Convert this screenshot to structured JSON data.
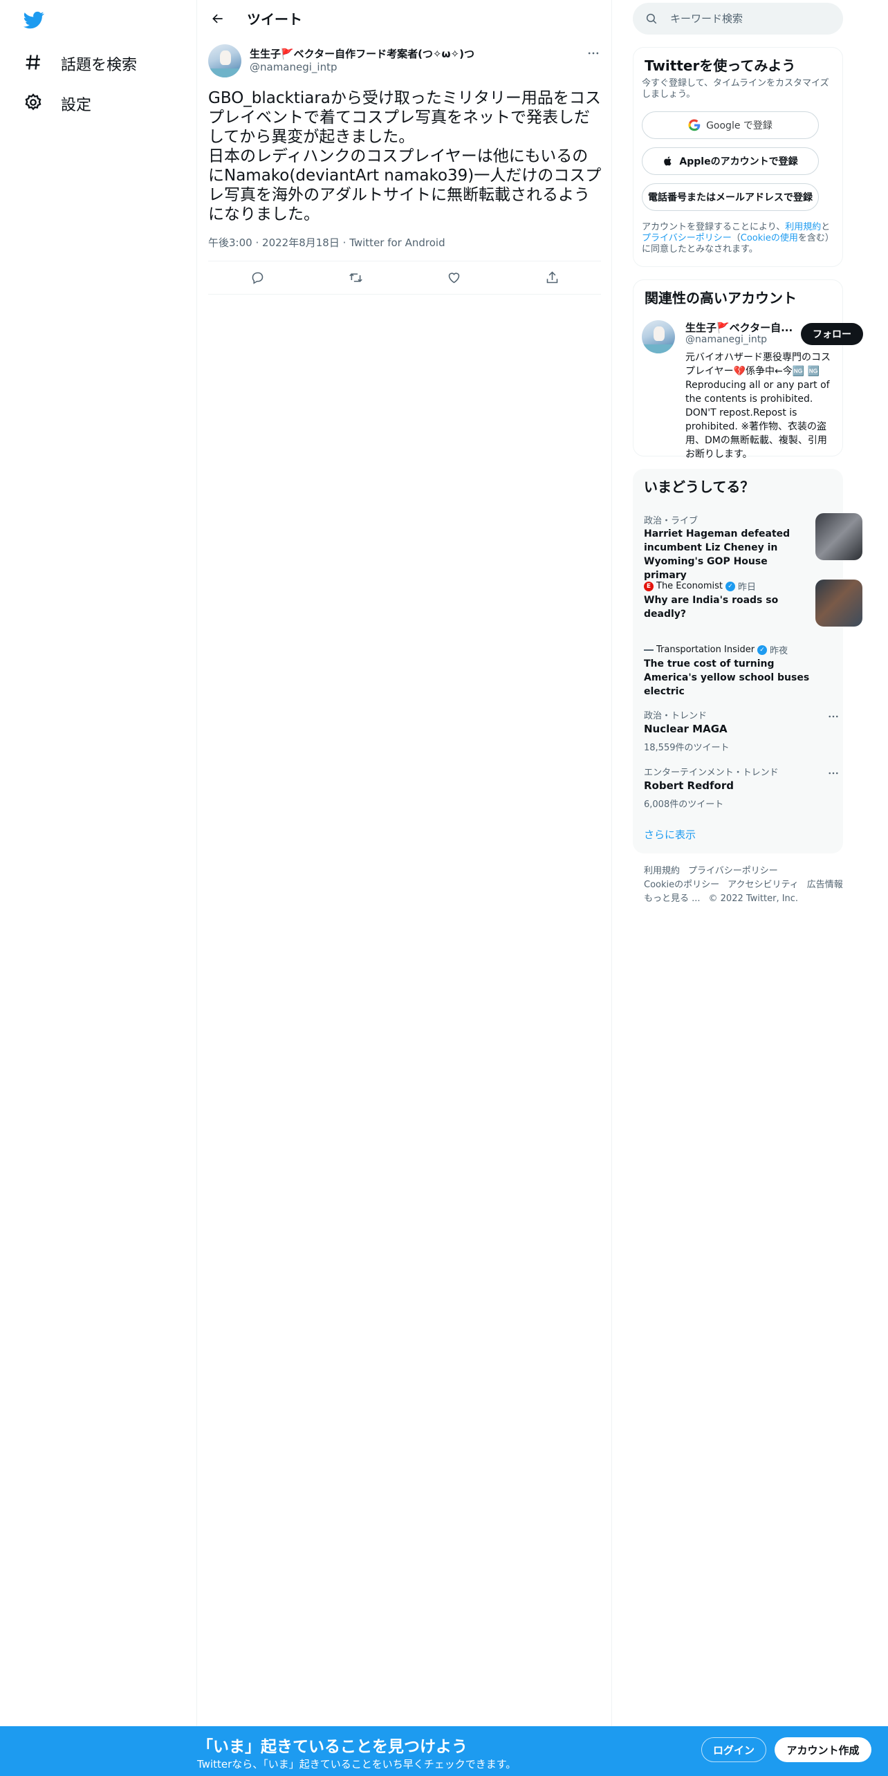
{
  "nav": {
    "logo": "twitter-bird-icon",
    "items": [
      {
        "label": "話題を検索",
        "icon": "hashtag-icon"
      },
      {
        "label": "設定",
        "icon": "gear-icon"
      }
    ]
  },
  "header": {
    "title": "ツイート"
  },
  "tweet": {
    "author_name": "生生子🚩ベクター自作フード考案者(つ✧ω✧)つ",
    "author_handle": "@namanegi_intp",
    "text": "GBO_blacktiaraから受け取ったミリタリー用品をコスプレイベントで着てコスプレ写真をネットで発表しだしてから異変が起きました。\n日本のレディハンクのコスプレイヤーは他にもいるのにNamako(deviantArt namako39)一人だけのコスプレ写真を海外のアダルトサイトに無断転載されるようになりました。",
    "time": "午後3:00",
    "date": "2022年8月18日",
    "source": "Twitter for Android",
    "sep": "·"
  },
  "search": {
    "placeholder": "キーワード検索"
  },
  "signup_card": {
    "title": "Twitterを使ってみよう",
    "subtitle": "今すぐ登録して、タイムラインをカスタマイズしましょう。",
    "google_label": "Google で登録",
    "apple_label": "Appleのアカウントで登録",
    "phone_label": "電話番号またはメールアドレスで登録",
    "terms_pre": "アカウントを登録することにより、",
    "terms_link1": "利用規約",
    "terms_mid1": "と",
    "terms_link2": "プライバシーポリシー",
    "terms_mid2": "（",
    "terms_link3": "Cookieの使用",
    "terms_post": "を含む）に同意したとみなされます。"
  },
  "related": {
    "title": "関連性の高いアカウント",
    "name": "生生子🚩ベクター自...",
    "handle": "@namanegi_intp",
    "follow_label": "フォロー",
    "bio": "元バイオハザード悪役専門のコスプレイヤー💔係争中←今🆖 🆖 Reproducing all or any part of the contents is prohibited. DON'T repost.Repost is prohibited. ※著作物、衣装の盗用、DMの無断転載、複製、引用お断りします。"
  },
  "trends": {
    "title": "いまどうしてる？",
    "items": [
      {
        "category": "政治・ライブ",
        "title": "Harriet Hageman defeated incumbent Liz Cheney in Wyoming's GOP House primary",
        "has_thumb": true
      },
      {
        "source": "The Economist",
        "time": "昨日",
        "title": "Why are India's roads so deadly?",
        "has_thumb": true
      },
      {
        "source": "Transportation Insider",
        "time": "昨夜",
        "title": "The true cost of turning America's yellow school buses electric",
        "has_thumb": false
      },
      {
        "category": "政治・トレンド",
        "title": "Nuclear MAGA",
        "count": "18,559件のツイート"
      },
      {
        "category": "エンターテインメント・トレンド",
        "title": "Robert Redford",
        "count": "6,008件のツイート"
      }
    ],
    "show_more": "さらに表示"
  },
  "footer": {
    "links": [
      "利用規約",
      "プライバシーポリシー",
      "Cookieのポリシー",
      "アクセシビリティ",
      "広告情報",
      "もっと見る ..."
    ],
    "copyright": "© 2022 Twitter, Inc."
  },
  "banner": {
    "title": "「いま」起きていることを見つけよう",
    "subtitle": "Twitterなら、「いま」起きていることをいち早くチェックできます。",
    "login_label": "ログイン",
    "signup_label": "アカウント作成"
  },
  "colors": {
    "accent": "#1d9bf0",
    "text": "#0f1419",
    "muted": "#536471"
  }
}
